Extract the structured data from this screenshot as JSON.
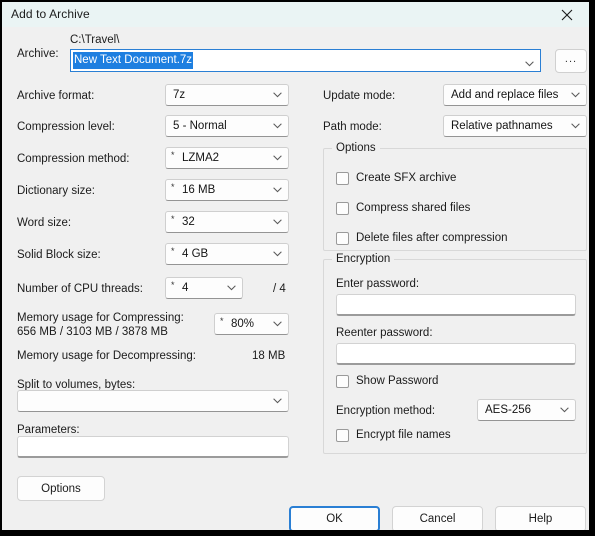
{
  "window": {
    "title": "Add to Archive",
    "close_icon": "close-icon"
  },
  "archive": {
    "label": "Archive:",
    "path": "C:\\Travel\\",
    "filename": "New Text Document.7z",
    "browse_label": "..."
  },
  "left_column": {
    "archive_format": {
      "label": "Archive format:",
      "value": "7z",
      "star": ""
    },
    "compression_level": {
      "label": "Compression level:",
      "value": "5 - Normal",
      "star": ""
    },
    "compression_method": {
      "label": "Compression method:",
      "value": "LZMA2",
      "star": "*"
    },
    "dictionary_size": {
      "label": "Dictionary size:",
      "value": "16 MB",
      "star": "*"
    },
    "word_size": {
      "label": "Word size:",
      "value": "32",
      "star": "*"
    },
    "solid_block_size": {
      "label": "Solid Block size:",
      "value": "4 GB",
      "star": "*"
    },
    "cpu_threads": {
      "label": "Number of CPU threads:",
      "value": "4",
      "star": "*",
      "total": "/ 4"
    },
    "memory_compressing": {
      "label": "Memory usage for Compressing:",
      "detail": "656 MB / 3103 MB / 3878 MB",
      "value": "80%",
      "star": "*"
    },
    "memory_decompressing": {
      "label": "Memory usage for Decompressing:",
      "value": "18 MB"
    },
    "split_volumes": {
      "label": "Split to volumes, bytes:",
      "value": ""
    },
    "parameters": {
      "label": "Parameters:",
      "value": ""
    },
    "options_button": "Options"
  },
  "right_column": {
    "update_mode": {
      "label": "Update mode:",
      "value": "Add and replace files"
    },
    "path_mode": {
      "label": "Path mode:",
      "value": "Relative pathnames"
    },
    "options_group": {
      "title": "Options",
      "items": [
        {
          "label": "Create SFX archive",
          "checked": false
        },
        {
          "label": "Compress shared files",
          "checked": false
        },
        {
          "label": "Delete files after compression",
          "checked": false
        }
      ]
    },
    "encryption_group": {
      "title": "Encryption",
      "enter_password_label": "Enter password:",
      "enter_password_value": "",
      "reenter_password_label": "Reenter password:",
      "reenter_password_value": "",
      "show_password": {
        "label": "Show Password",
        "checked": false
      },
      "encryption_method_label": "Encryption method:",
      "encryption_method_value": "AES-256",
      "encrypt_file_names": {
        "label": "Encrypt file names",
        "checked": false
      }
    }
  },
  "footer": {
    "ok": "OK",
    "cancel": "Cancel",
    "help": "Help"
  },
  "colors": {
    "titlebar": "#eaf4f4",
    "dialog_bg": "#f0f0f0",
    "accent": "#2a7fd4",
    "selection": "#1e7fe0"
  }
}
